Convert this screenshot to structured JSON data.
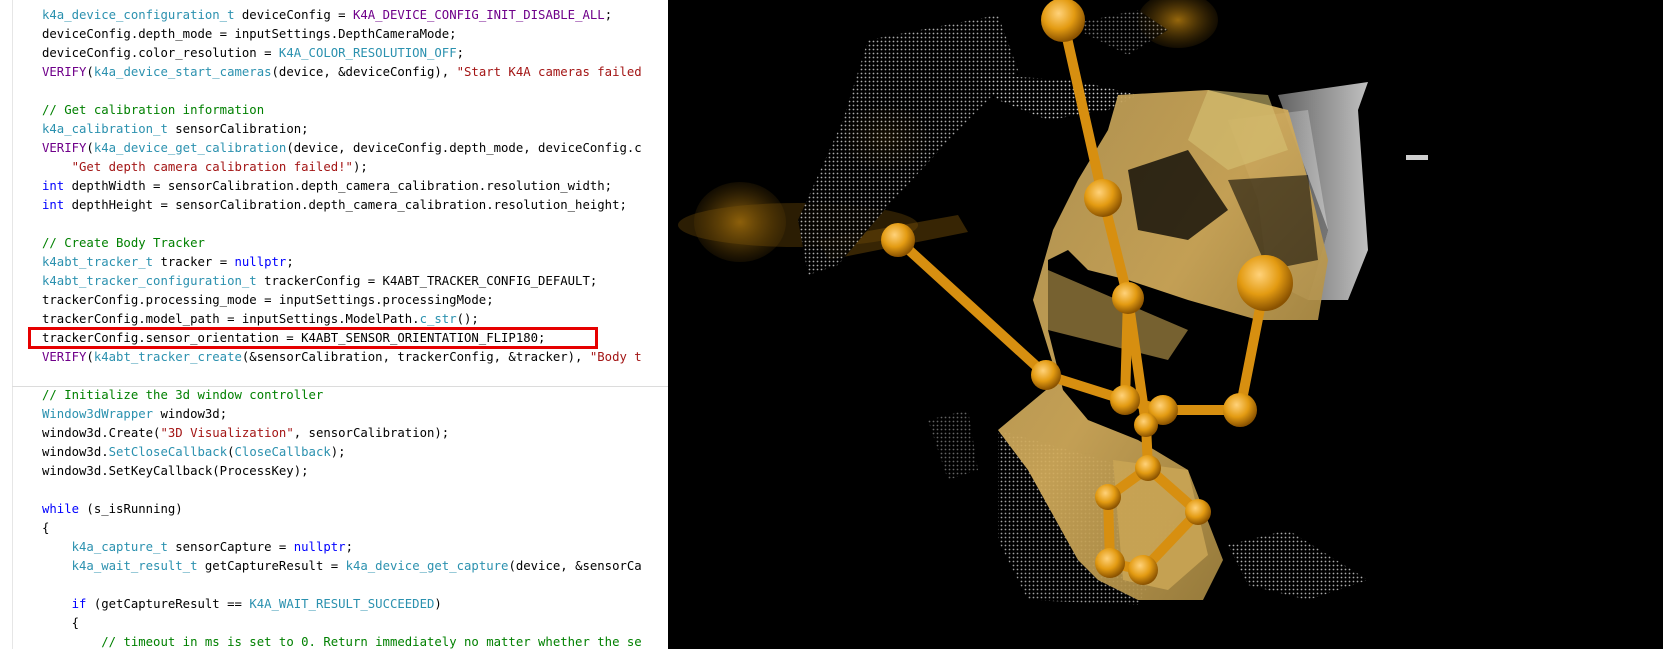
{
  "code_editor": {
    "lines": [
      [
        {
          "t": "k4a_device_configuration_t",
          "c": "ty"
        },
        {
          "t": " deviceConfig = ",
          "c": ""
        },
        {
          "t": "K4A_DEVICE_CONFIG_INIT_DISABLE_ALL",
          "c": "mc"
        },
        {
          "t": ";",
          "c": ""
        }
      ],
      [
        {
          "t": "deviceConfig.depth_mode = inputSettings.DepthCameraMode;",
          "c": ""
        }
      ],
      [
        {
          "t": "deviceConfig.color_resolution = ",
          "c": ""
        },
        {
          "t": "K4A_COLOR_RESOLUTION_OFF",
          "c": "ty"
        },
        {
          "t": ";",
          "c": ""
        }
      ],
      [
        {
          "t": "VERIFY",
          "c": "mc"
        },
        {
          "t": "(",
          "c": ""
        },
        {
          "t": "k4a_device_start_cameras",
          "c": "ty"
        },
        {
          "t": "(device, &deviceConfig), ",
          "c": ""
        },
        {
          "t": "\"Start K4A cameras failed",
          "c": "st"
        }
      ],
      [],
      [
        {
          "t": "// Get calibration information",
          "c": "cm"
        }
      ],
      [
        {
          "t": "k4a_calibration_t",
          "c": "ty"
        },
        {
          "t": " sensorCalibration;",
          "c": ""
        }
      ],
      [
        {
          "t": "VERIFY",
          "c": "mc"
        },
        {
          "t": "(",
          "c": ""
        },
        {
          "t": "k4a_device_get_calibration",
          "c": "ty"
        },
        {
          "t": "(device, deviceConfig.depth_mode, deviceConfig.c",
          "c": ""
        }
      ],
      [
        {
          "t": "    ",
          "c": ""
        },
        {
          "t": "\"Get depth camera calibration failed!\"",
          "c": "st"
        },
        {
          "t": ");",
          "c": ""
        }
      ],
      [
        {
          "t": "int",
          "c": "kw"
        },
        {
          "t": " depthWidth = sensorCalibration.depth_camera_calibration.resolution_width;",
          "c": ""
        }
      ],
      [
        {
          "t": "int",
          "c": "kw"
        },
        {
          "t": " depthHeight = sensorCalibration.depth_camera_calibration.resolution_height;",
          "c": ""
        }
      ],
      [],
      [
        {
          "t": "// Create Body Tracker",
          "c": "cm"
        }
      ],
      [
        {
          "t": "k4abt_tracker_t",
          "c": "ty"
        },
        {
          "t": " tracker = ",
          "c": ""
        },
        {
          "t": "nullptr",
          "c": "kw"
        },
        {
          "t": ";",
          "c": ""
        }
      ],
      [
        {
          "t": "k4abt_tracker_configuration_t",
          "c": "ty"
        },
        {
          "t": " trackerConfig = K4ABT_TRACKER_CONFIG_DEFAULT;",
          "c": ""
        }
      ],
      [
        {
          "t": "trackerConfig.processing_mode = inputSettings.processingMode;",
          "c": ""
        }
      ],
      [
        {
          "t": "trackerConfig.model_path = inputSettings.ModelPath.",
          "c": ""
        },
        {
          "t": "c_str",
          "c": "ty"
        },
        {
          "t": "();",
          "c": ""
        }
      ],
      [
        {
          "t": "trackerConfig.sensor_orientation = K4ABT_SENSOR_ORIENTATION_FLIP180;",
          "c": ""
        }
      ],
      [
        {
          "t": "VERIFY",
          "c": "mc"
        },
        {
          "t": "(",
          "c": ""
        },
        {
          "t": "k4abt_tracker_create",
          "c": "ty"
        },
        {
          "t": "(&sensorCalibration, trackerConfig, &tracker), ",
          "c": ""
        },
        {
          "t": "\"Body t",
          "c": "st"
        }
      ],
      [],
      [
        {
          "t": "// Initialize the 3d window controller",
          "c": "cm"
        }
      ],
      [
        {
          "t": "Window3dWrapper",
          "c": "ty"
        },
        {
          "t": " window3d;",
          "c": ""
        }
      ],
      [
        {
          "t": "window3d.Create(",
          "c": ""
        },
        {
          "t": "\"3D Visualization\"",
          "c": "st"
        },
        {
          "t": ", sensorCalibration);",
          "c": ""
        }
      ],
      [
        {
          "t": "window3d.",
          "c": ""
        },
        {
          "t": "SetCloseCallback",
          "c": "ty"
        },
        {
          "t": "(",
          "c": ""
        },
        {
          "t": "CloseCallback",
          "c": "ty"
        },
        {
          "t": ");",
          "c": ""
        }
      ],
      [
        {
          "t": "window3d.SetKeyCallback(ProcessKey);",
          "c": ""
        }
      ],
      [],
      [
        {
          "t": "while",
          "c": "kw"
        },
        {
          "t": " (s_isRunning)",
          "c": ""
        }
      ],
      [
        {
          "t": "{",
          "c": ""
        }
      ],
      [
        {
          "t": "    ",
          "c": ""
        },
        {
          "t": "k4a_capture_t",
          "c": "ty"
        },
        {
          "t": " sensorCapture = ",
          "c": ""
        },
        {
          "t": "nullptr",
          "c": "kw"
        },
        {
          "t": ";",
          "c": ""
        }
      ],
      [
        {
          "t": "    ",
          "c": ""
        },
        {
          "t": "k4a_wait_result_t",
          "c": "ty"
        },
        {
          "t": " getCaptureResult = ",
          "c": ""
        },
        {
          "t": "k4a_device_get_capture",
          "c": "ty"
        },
        {
          "t": "(device, &sensorCa",
          "c": ""
        }
      ],
      [],
      [
        {
          "t": "    ",
          "c": ""
        },
        {
          "t": "if",
          "c": "kw"
        },
        {
          "t": " (getCaptureResult == ",
          "c": ""
        },
        {
          "t": "K4A_WAIT_RESULT_SUCCEEDED",
          "c": "ty"
        },
        {
          "t": ")",
          "c": ""
        }
      ],
      [
        {
          "t": "    {",
          "c": ""
        }
      ],
      [
        {
          "t": "        ",
          "c": ""
        },
        {
          "t": "// timeout in ms is set to 0. Return immediately no matter whether the se",
          "c": "cm"
        }
      ]
    ],
    "highlighted_line_index": 17
  },
  "viewer": {
    "background": "#000000",
    "skeleton_color": "#e09a10",
    "body_color": "#c9a24a",
    "point_cloud_color": "#b8b8b8"
  }
}
